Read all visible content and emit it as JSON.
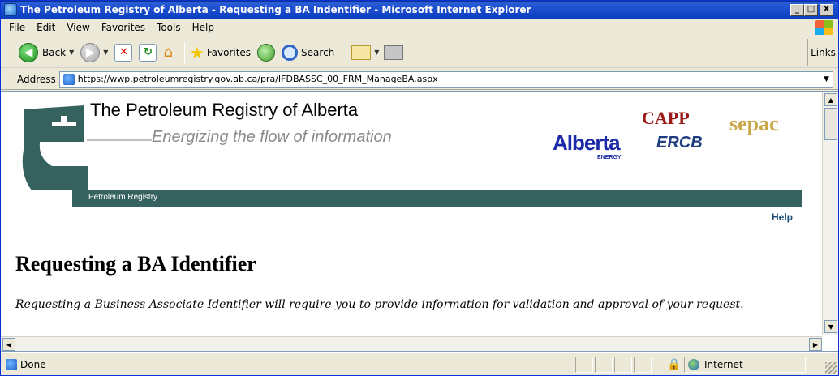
{
  "window": {
    "title": "The Petroleum Registry of Alberta - Requesting a BA Indentifier - Microsoft Internet Explorer",
    "buttons": {
      "minimize": "_",
      "maximize": "□",
      "close": "X"
    }
  },
  "menu": {
    "items": [
      {
        "label": "File"
      },
      {
        "label": "Edit"
      },
      {
        "label": "View"
      },
      {
        "label": "Favorites"
      },
      {
        "label": "Tools"
      },
      {
        "label": "Help"
      }
    ]
  },
  "toolbar": {
    "back_label": "Back",
    "favorites_label": "Favorites",
    "search_label": "Search",
    "links_label": "Links"
  },
  "address": {
    "label": "Address",
    "url": "https://wwp.petroleumregistry.gov.ab.ca/pra/IFDBASSC_00_FRM_ManageBA.aspx"
  },
  "page": {
    "site_title": "The Petroleum Registry of Alberta",
    "tagline": "Energizing the flow of information",
    "nav_label": "Petroleum Registry",
    "help_link": "Help",
    "logos": {
      "alberta": "Alberta",
      "alberta_sub": "ENERGY",
      "capp": "CAPP",
      "ercb": "ERCB",
      "sepac": "sepac"
    },
    "heading": "Requesting a BA Identifier",
    "intro": "Requesting a Business Associate Identifier will require you to provide information for validation and approval of your request."
  },
  "status": {
    "text": "Done",
    "zone": "Internet"
  },
  "colors": {
    "banner_green": "#35625f",
    "title_blue": "#0b3ec0"
  }
}
